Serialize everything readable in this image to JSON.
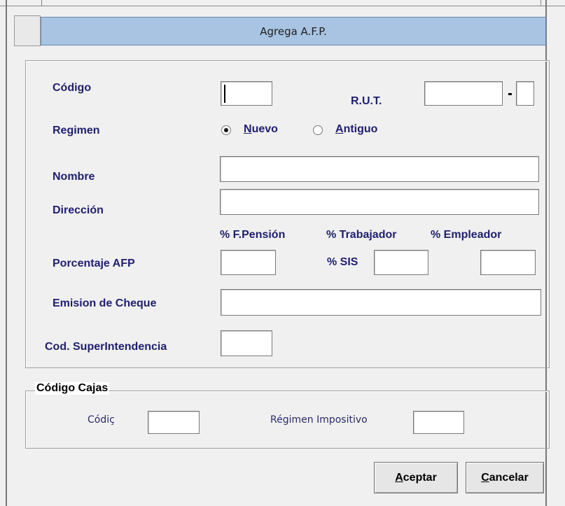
{
  "dialog": {
    "title": "Agrega A.F.P."
  },
  "form": {
    "codigo_label": "Código",
    "rut_label": "R.U.T.",
    "regimen_label": "Regimen",
    "regimen_options": [
      {
        "label_first": "N",
        "label_rest": "uevo",
        "selected": true
      },
      {
        "label_first": "A",
        "label_rest": "ntiguo",
        "selected": false
      }
    ],
    "nombre_label": "Nombre",
    "direccion_label": "Dirección",
    "pct_fpension_label": "% F.Pensión",
    "pct_trabajador_label": "% Trabajador",
    "pct_empleador_label": "% Empleador",
    "porcentaje_afp_label": "Porcentaje AFP",
    "pct_sis_label": "% SIS",
    "emision_cheque_label": "Emision de Cheque",
    "cod_superintendencia_label": "Cod. SuperIntendencia",
    "values": {
      "codigo": "",
      "rut": "",
      "rut_dv": "",
      "nombre": "",
      "direccion": "",
      "pct_fpension": "",
      "pct_sis": "",
      "pct_empleador": "",
      "emision_cheque": "",
      "cod_superintendencia": ""
    }
  },
  "cajas": {
    "caption": "Código Cajas",
    "codigo_label": "Códiç",
    "regimen_impositivo_label": "Régimen Impositivo",
    "values": {
      "codigo": "",
      "regimen_impositivo": ""
    }
  },
  "buttons": {
    "aceptar_first": "A",
    "aceptar_rest": "ceptar",
    "cancelar_first": "C",
    "cancelar_rest": "ancelar"
  }
}
